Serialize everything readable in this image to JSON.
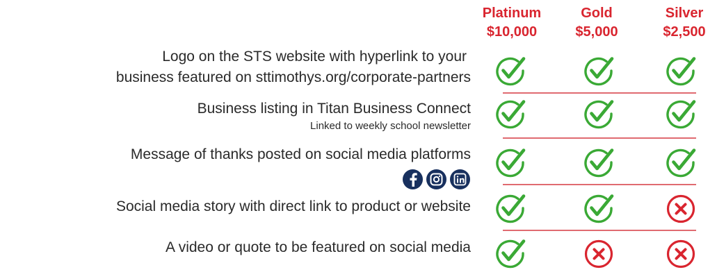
{
  "tiers": [
    {
      "name": "Platinum",
      "price": "$10,000"
    },
    {
      "name": "Gold",
      "price": "$5,000"
    },
    {
      "name": "Silver",
      "price": "$2,500"
    }
  ],
  "features": [
    {
      "line1": "Logo on the STS website with hyperlink to your",
      "line2": "business featured on sttimothys.org/corporate-partners",
      "included": [
        true,
        true,
        true
      ]
    },
    {
      "line1": "Business listing in Titan Business Connect",
      "sub": "Linked to weekly school newsletter",
      "included": [
        true,
        true,
        true
      ]
    },
    {
      "line1": "Message of thanks posted on social media platforms",
      "included": [
        true,
        true,
        true
      ]
    },
    {
      "line1": "Social media story with direct link to product or website",
      "included": [
        true,
        true,
        false
      ]
    },
    {
      "line1": "A video or quote to be featured on social media",
      "included": [
        true,
        false,
        false
      ]
    }
  ],
  "social_icons": [
    "facebook-icon",
    "instagram-icon",
    "linkedin-icon"
  ],
  "colors": {
    "accent": "#d9252f",
    "check": "#3aa935",
    "cross": "#d9252f",
    "divider": "#e06a70",
    "social": "#18305e"
  }
}
